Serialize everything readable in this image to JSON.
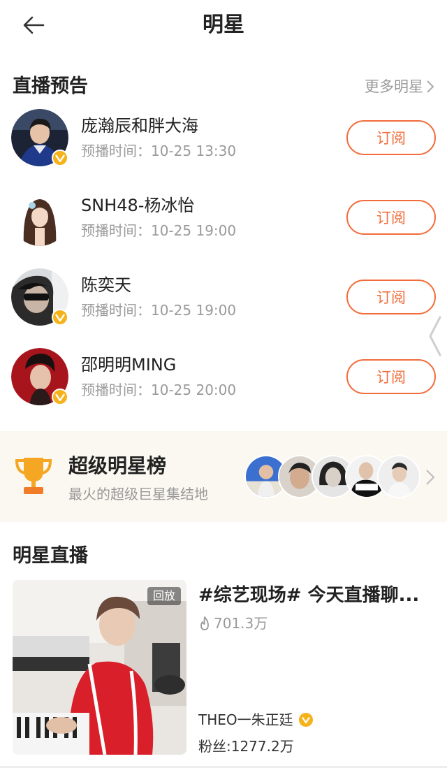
{
  "header": {
    "title": "明星",
    "back_icon": "back-arrow-icon"
  },
  "preview_section": {
    "title": "直播预告",
    "more_label": "更多明星",
    "items": [
      {
        "name": "庞瀚辰和胖大海",
        "time": "预播时间：10-25 13:30",
        "button": "订阅",
        "verified": true
      },
      {
        "name": "SNH48-杨冰怡",
        "time": "预播时间：10-25 19:00",
        "button": "订阅",
        "verified": false
      },
      {
        "name": "陈奕天",
        "time": "预播时间：10-25 19:00",
        "button": "订阅",
        "verified": true
      },
      {
        "name": "邵明明MING",
        "time": "预播时间：10-25 20:00",
        "button": "订阅",
        "verified": true
      }
    ]
  },
  "banner": {
    "title": "超级明星榜",
    "subtitle": "最火的超级巨星集结地",
    "icon": "trophy-icon"
  },
  "live_section": {
    "title": "明星直播",
    "card": {
      "badge": "回放",
      "title": "#综艺现场# 今天直播聊...",
      "views": "701.3万",
      "host": "THEO一朱正廷",
      "fans": "粉丝:1277.2万"
    }
  },
  "colors": {
    "accent": "#f26b3a",
    "verified": "#f6b21b",
    "muted": "#999999",
    "banner_bg": "#fbf8f1"
  }
}
